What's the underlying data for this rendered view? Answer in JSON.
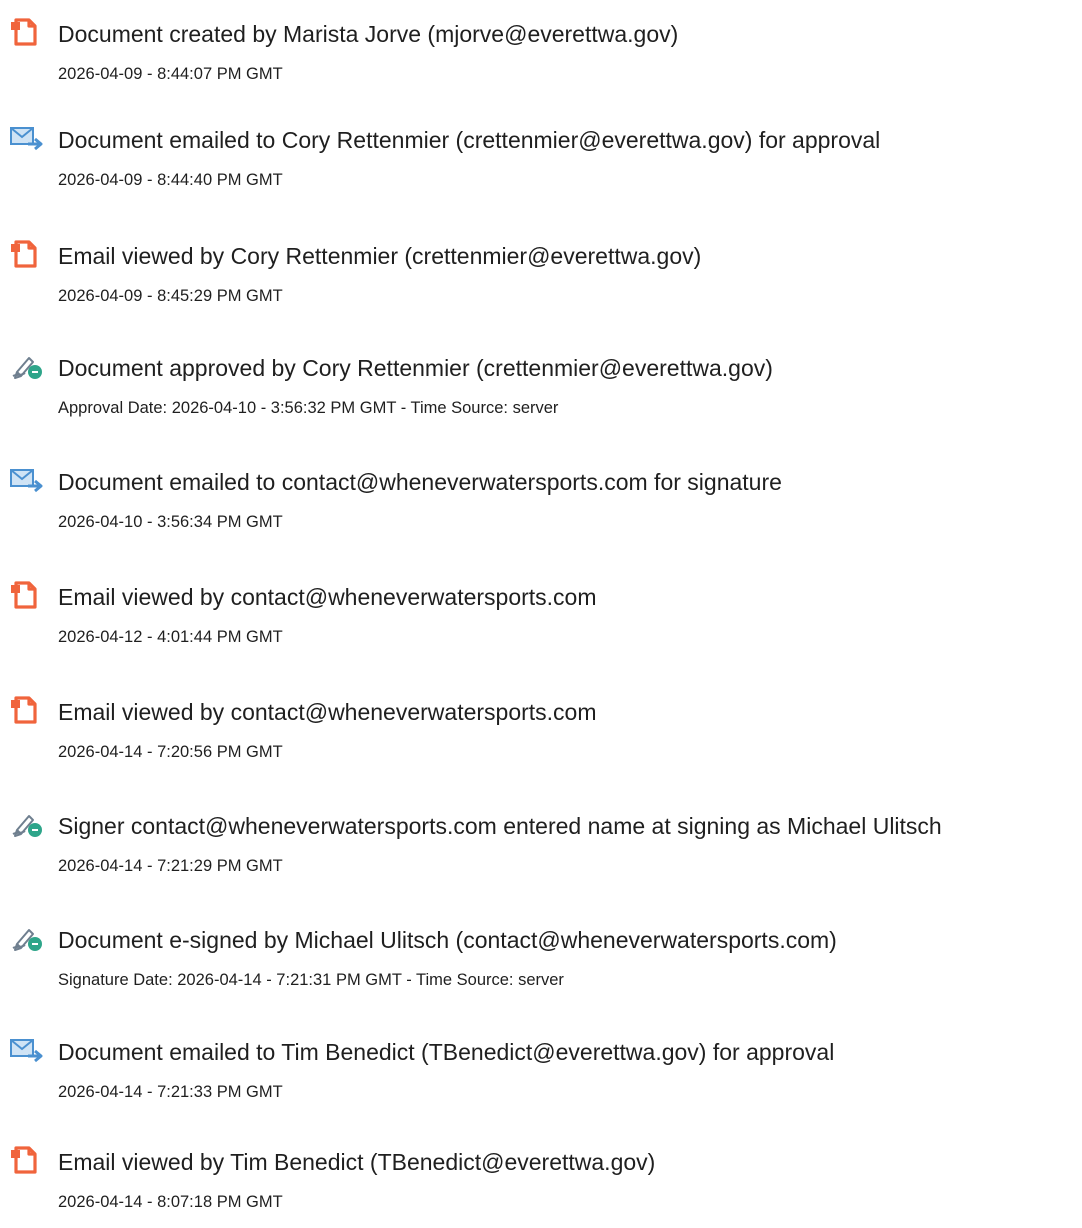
{
  "colors": {
    "doc_icon": "#f0643c",
    "mail_icon_body": "#cfe3f5",
    "mail_icon_stroke": "#4a90d0",
    "sign_icon_pen": "#6f7f8f",
    "sign_icon_badge": "#2ea58a"
  },
  "events": [
    {
      "icon": "document-icon",
      "title": "Document created by Marista Jorve (mjorve@everettwa.gov)",
      "meta": "2026-04-09 - 8:44:07 PM GMT"
    },
    {
      "icon": "email-sent-icon",
      "title": "Document emailed to Cory Rettenmier (crettenmier@everettwa.gov) for approval",
      "meta": "2026-04-09 - 8:44:40 PM GMT"
    },
    {
      "icon": "document-icon",
      "title": "Email viewed by Cory Rettenmier (crettenmier@everettwa.gov)",
      "meta": "2026-04-09 - 8:45:29 PM GMT"
    },
    {
      "icon": "signature-icon",
      "title": "Document approved by Cory Rettenmier (crettenmier@everettwa.gov)",
      "meta": "Approval Date: 2026-04-10 - 3:56:32 PM GMT - Time Source: server"
    },
    {
      "icon": "email-sent-icon",
      "title": "Document emailed to contact@wheneverwatersports.com for signature",
      "meta": "2026-04-10 - 3:56:34 PM GMT"
    },
    {
      "icon": "document-icon",
      "title": "Email viewed by contact@wheneverwatersports.com",
      "meta": "2026-04-12 - 4:01:44 PM GMT"
    },
    {
      "icon": "document-icon",
      "title": "Email viewed by contact@wheneverwatersports.com",
      "meta": "2026-04-14 - 7:20:56 PM GMT"
    },
    {
      "icon": "signature-icon",
      "title": "Signer contact@wheneverwatersports.com entered name at signing as Michael Ulitsch",
      "meta": "2026-04-14 - 7:21:29 PM GMT"
    },
    {
      "icon": "signature-icon",
      "title": "Document e-signed by Michael Ulitsch (contact@wheneverwatersports.com)",
      "meta": "Signature Date: 2026-04-14 - 7:21:31 PM GMT - Time Source: server"
    },
    {
      "icon": "email-sent-icon",
      "title": "Document emailed to Tim Benedict (TBenedict@everettwa.gov) for approval",
      "meta": "2026-04-14 - 7:21:33 PM GMT"
    },
    {
      "icon": "document-icon",
      "title": "Email viewed by Tim Benedict (TBenedict@everettwa.gov)",
      "meta": "2026-04-14 - 8:07:18 PM GMT"
    }
  ]
}
